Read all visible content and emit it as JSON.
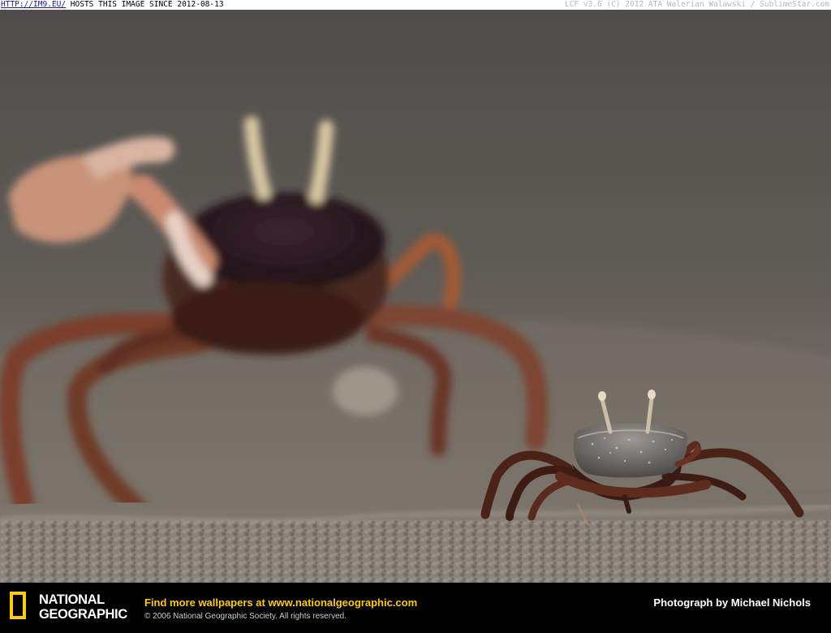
{
  "watermark": {
    "link": "HTTP://IM9.EU/",
    "hosts_text": " HOSTS THIS IMAGE SINCE 2012-08-13",
    "right_text": "LCF v3.6 (C) 2012 ATA Walerian Walawski / SublimeStar.com"
  },
  "photo": {
    "subject": "fiddler crabs on sand",
    "colors": {
      "background": "#5a5754",
      "sand": "#8a847c",
      "crab": "#5a2a1e"
    }
  },
  "footer": {
    "logo_line1": "NATIONAL",
    "logo_line2": "GEOGRAPHIC",
    "promo_text": "Find more wallpapers at ",
    "promo_url": "www.nationalgeographic.com",
    "copyright": "© 2006 National Geographic Society. All rights reserved.",
    "credit": "Photograph by Michael Nichols",
    "colors": {
      "brand_yellow": "#ffcc00",
      "background": "#000000"
    }
  }
}
